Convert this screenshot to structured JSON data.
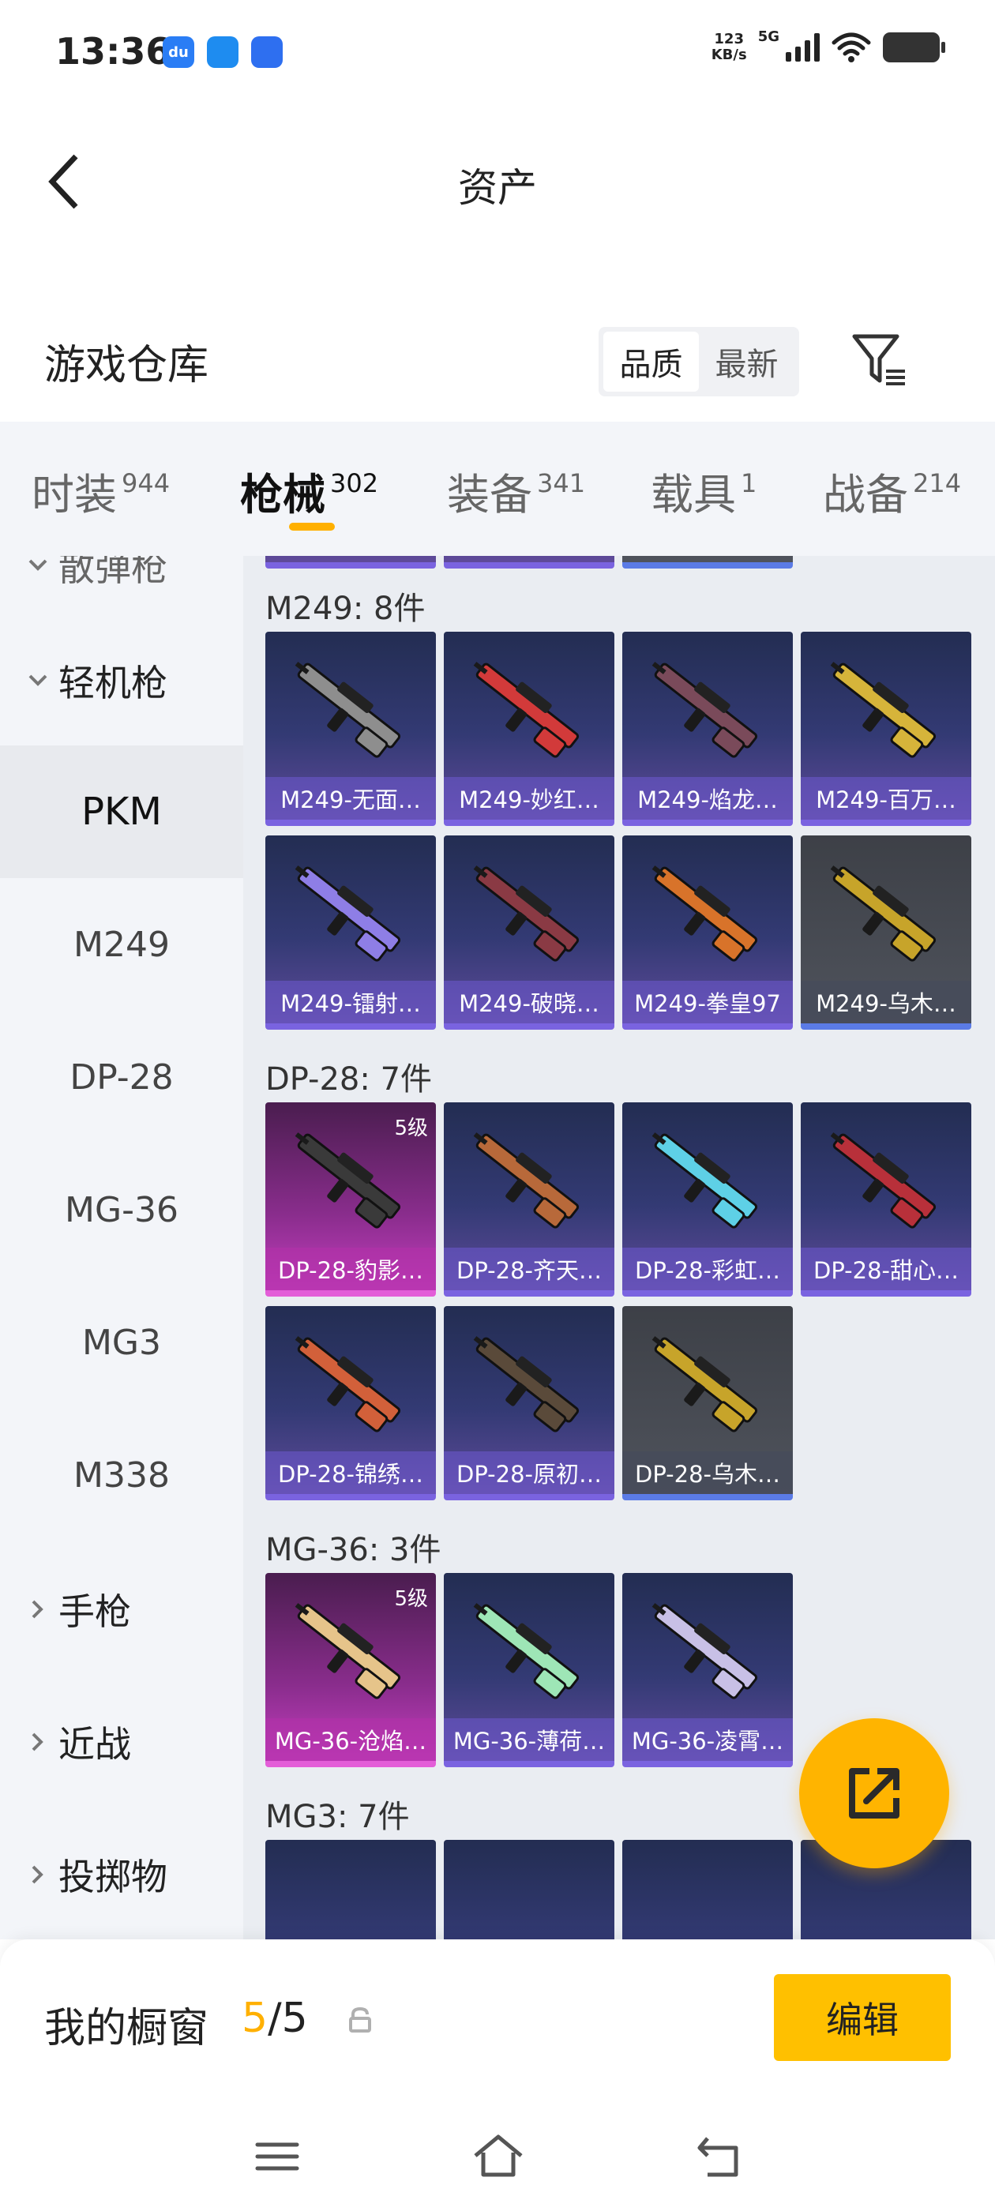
{
  "status": {
    "time": "13:36",
    "net_speed_value": "123",
    "net_speed_unit": "KB/s",
    "signal_label": "5G",
    "apps": [
      {
        "name": "du",
        "color": "#2a7df5"
      },
      {
        "name": "",
        "color": "#1e8cf0"
      },
      {
        "name": "",
        "color": "#2e6ff0"
      }
    ]
  },
  "header": {
    "title": "资产",
    "back_icon": "chevron-left-icon"
  },
  "warehouse": {
    "title": "游戏仓库",
    "sort_options": [
      "品质",
      "最新"
    ],
    "sort_selected": "品质",
    "filter_icon": "filter-icon"
  },
  "tabs": [
    {
      "label": "时装",
      "count": "944"
    },
    {
      "label": "枪械",
      "count": "302",
      "active": true
    },
    {
      "label": "装备",
      "count": "341"
    },
    {
      "label": "载具",
      "count": "1"
    },
    {
      "label": "战备",
      "count": "214"
    }
  ],
  "sidebar": {
    "partial_top": "散弹枪",
    "category": "轻机枪",
    "items": [
      "PKM",
      "M249",
      "DP-28",
      "MG-36",
      "MG3",
      "M338"
    ],
    "selected": "PKM",
    "more_categories": [
      "手枪",
      "近战",
      "投掷物"
    ]
  },
  "sections": [
    {
      "title": "M249: 8件",
      "items": [
        {
          "label": "M249-无面…",
          "tier": "blue",
          "gun_color": "#8e8e8e"
        },
        {
          "label": "M249-妙红…",
          "tier": "blue",
          "gun_color": "#d23a3a"
        },
        {
          "label": "M249-焰龙…",
          "tier": "blue",
          "gun_color": "#7a4a5a"
        },
        {
          "label": "M249-百万…",
          "tier": "blue",
          "gun_color": "#d6b43a"
        },
        {
          "label": "M249-镭射…",
          "tier": "blue",
          "gun_color": "#8e7ee6"
        },
        {
          "label": "M249-破晓…",
          "tier": "blue",
          "gun_color": "#8a3a44"
        },
        {
          "label": "M249-拳皇97",
          "tier": "blue",
          "gun_color": "#d8732a"
        },
        {
          "label": "M249-乌木…",
          "tier": "grey",
          "gun_color": "#c7a42a"
        }
      ]
    },
    {
      "title": "DP-28: 7件",
      "items": [
        {
          "label": "DP-28-豹影…",
          "tier": "purple",
          "level": "5级",
          "gun_color": "#3a3a3a"
        },
        {
          "label": "DP-28-齐天…",
          "tier": "blue",
          "gun_color": "#b8693a"
        },
        {
          "label": "DP-28-彩虹…",
          "tier": "blue",
          "gun_color": "#5ed0e6"
        },
        {
          "label": "DP-28-甜心…",
          "tier": "blue",
          "gun_color": "#b8303a"
        },
        {
          "label": "DP-28-锦绣…",
          "tier": "blue",
          "gun_color": "#d2603a"
        },
        {
          "label": "DP-28-原初…",
          "tier": "blue",
          "gun_color": "#5a4a3a"
        },
        {
          "label": "DP-28-乌木…",
          "tier": "grey",
          "gun_color": "#c7a42a"
        }
      ]
    },
    {
      "title": "MG-36: 3件",
      "items": [
        {
          "label": "MG-36-沧焰…",
          "tier": "purple",
          "level": "5级",
          "gun_color": "#e6c48a"
        },
        {
          "label": "MG-36-薄荷…",
          "tier": "blue",
          "gun_color": "#9ee6b6"
        },
        {
          "label": "MG-36-凌霄…",
          "tier": "blue",
          "gun_color": "#c8c0e6"
        }
      ]
    },
    {
      "title": "MG3: 7件",
      "items": []
    }
  ],
  "showcase": {
    "title": "我的橱窗",
    "count_current": "5",
    "count_sep": "/5",
    "edit_label": "编辑"
  }
}
